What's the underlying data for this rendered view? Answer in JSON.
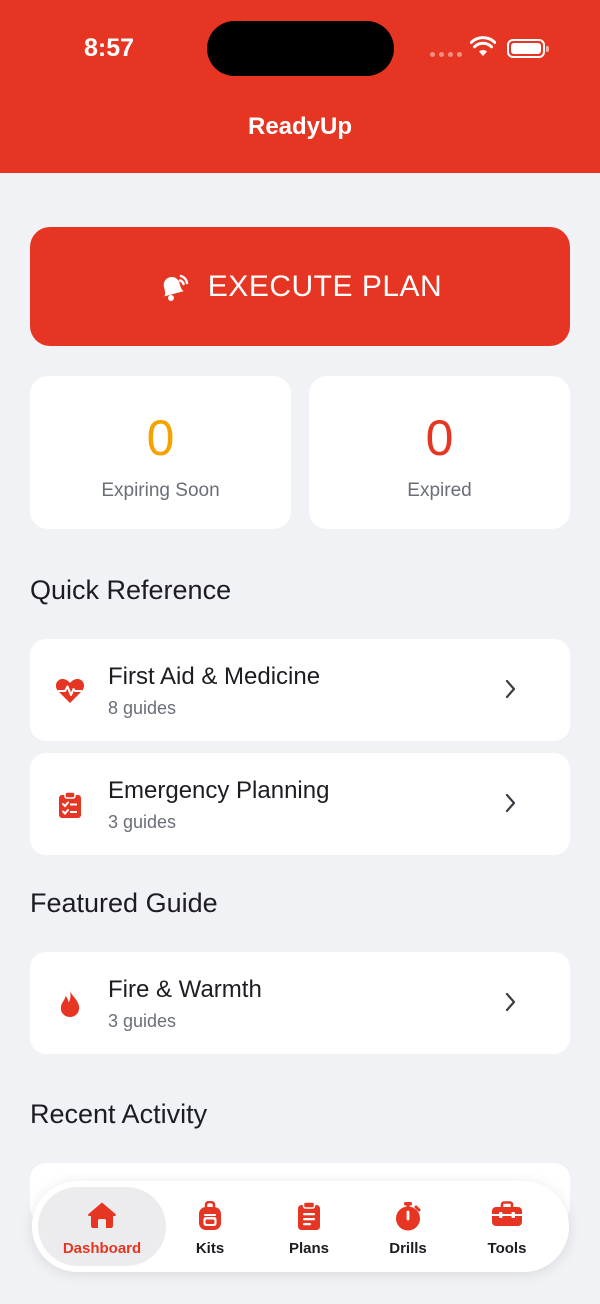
{
  "status_bar": {
    "time": "8:57"
  },
  "app": {
    "title": "ReadyUp",
    "accent": "#e63522"
  },
  "execute": {
    "label": "EXECUTE PLAN",
    "icon": "alarm-bell-icon"
  },
  "stats": [
    {
      "value": "0",
      "label": "Expiring Soon",
      "color": "#f5a300"
    },
    {
      "value": "0",
      "label": "Expired",
      "color": "#e63522"
    }
  ],
  "sections": {
    "quick_reference": "Quick Reference",
    "featured_guide": "Featured Guide",
    "recent_activity": "Recent Activity"
  },
  "quick_reference": [
    {
      "title": "First Aid & Medicine",
      "subtitle": "8 guides",
      "icon": "heart-pulse-icon"
    },
    {
      "title": "Emergency Planning",
      "subtitle": "3 guides",
      "icon": "clipboard-check-icon"
    }
  ],
  "featured_guide": {
    "title": "Fire & Warmth",
    "subtitle": "3 guides",
    "icon": "flame-icon"
  },
  "tabs": [
    {
      "label": "Dashboard",
      "icon": "home-icon",
      "active": true
    },
    {
      "label": "Kits",
      "icon": "backpack-icon",
      "active": false
    },
    {
      "label": "Plans",
      "icon": "clipboard-icon",
      "active": false
    },
    {
      "label": "Drills",
      "icon": "stopwatch-icon",
      "active": false
    },
    {
      "label": "Tools",
      "icon": "toolbox-icon",
      "active": false
    }
  ]
}
